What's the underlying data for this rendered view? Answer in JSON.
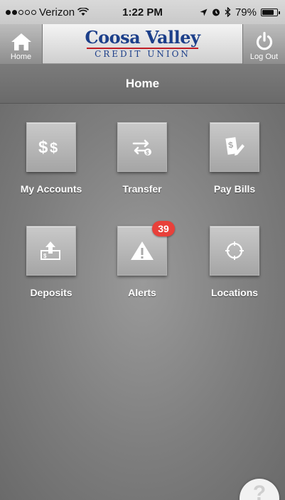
{
  "status_bar": {
    "carrier": "Verizon",
    "time": "1:22 PM",
    "battery": "79%",
    "battery_level": 0.79
  },
  "header": {
    "home_label": "Home",
    "logout_label": "Log Out",
    "logo_top": "Coosa Valley",
    "logo_bottom": "CREDIT UNION"
  },
  "title": "Home",
  "tiles": [
    {
      "label": "My Accounts",
      "icon": "dollar-icon"
    },
    {
      "label": "Transfer",
      "icon": "transfer-arrows-icon"
    },
    {
      "label": "Pay Bills",
      "icon": "pay-bill-pen-icon"
    },
    {
      "label": "Deposits",
      "icon": "deposit-check-icon"
    },
    {
      "label": "Alerts",
      "icon": "warning-triangle-icon",
      "badge": "39"
    },
    {
      "label": "Locations",
      "icon": "crosshair-icon"
    }
  ],
  "help": {
    "icon": "help-question-icon",
    "glyph": "?"
  },
  "colors": {
    "logo_blue": "#1c3f8a",
    "logo_red": "#c11c24",
    "badge_red": "#e8403a"
  }
}
